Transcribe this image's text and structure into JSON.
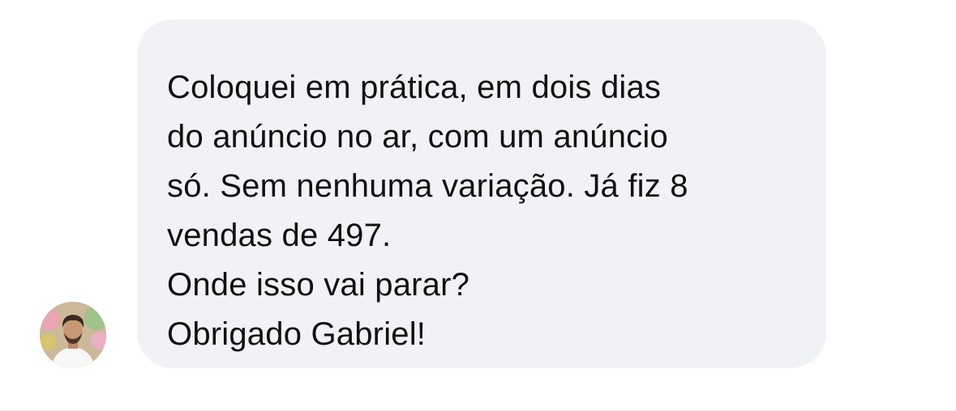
{
  "message": {
    "lines": [
      "Coloquei em prática, em dois dias",
      "do anúncio no ar, com um anúncio",
      "só. Sem nenhuma variação. Já fiz 8",
      "vendas de 497.",
      "Onde isso vai parar?",
      "Obrigado Gabriel!"
    ],
    "bubble_color": "#f1f2f5",
    "text_color": "#111111"
  },
  "sender": {
    "avatar_icon": "user-avatar-photo"
  }
}
